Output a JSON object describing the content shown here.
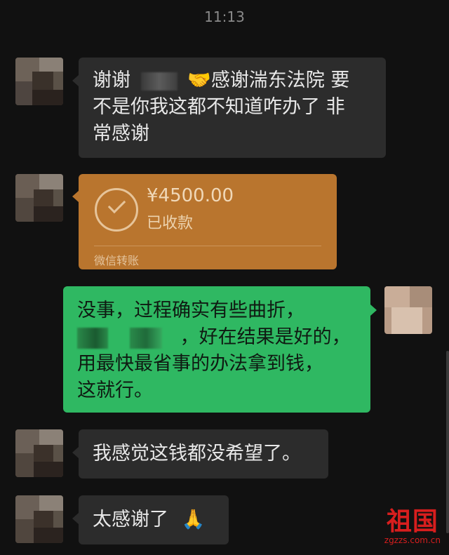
{
  "status_time": "11:13",
  "messages": {
    "m1": {
      "part1": "谢谢",
      "emoji": "🤝",
      "part2": "感谢湍东法院 要",
      "line2": "不是你我这都不知道咋办了 非",
      "line3": "常感谢"
    },
    "m2_transfer": {
      "amount": "¥4500.00",
      "status": "已收款",
      "source": "微信转账"
    },
    "m3": {
      "line1": "没事，过程确实有些曲折，",
      "line2_suffix": "，好在结果是好的，",
      "line3": "用最快最省事的办法拿到钱，",
      "line4": "这就行。"
    },
    "m4": {
      "text": "我感觉这钱都没希望了。"
    },
    "m5": {
      "text": "太感谢了",
      "emoji": "🙏"
    }
  },
  "watermark": {
    "main": "祖国",
    "sub": "zgzzs.com.cn"
  },
  "colors": {
    "background": "#111111",
    "bubble_left": "#2c2c2c",
    "bubble_right": "#2fb862",
    "transfer_card": "#b9752e",
    "watermark": "#d81e1e"
  }
}
